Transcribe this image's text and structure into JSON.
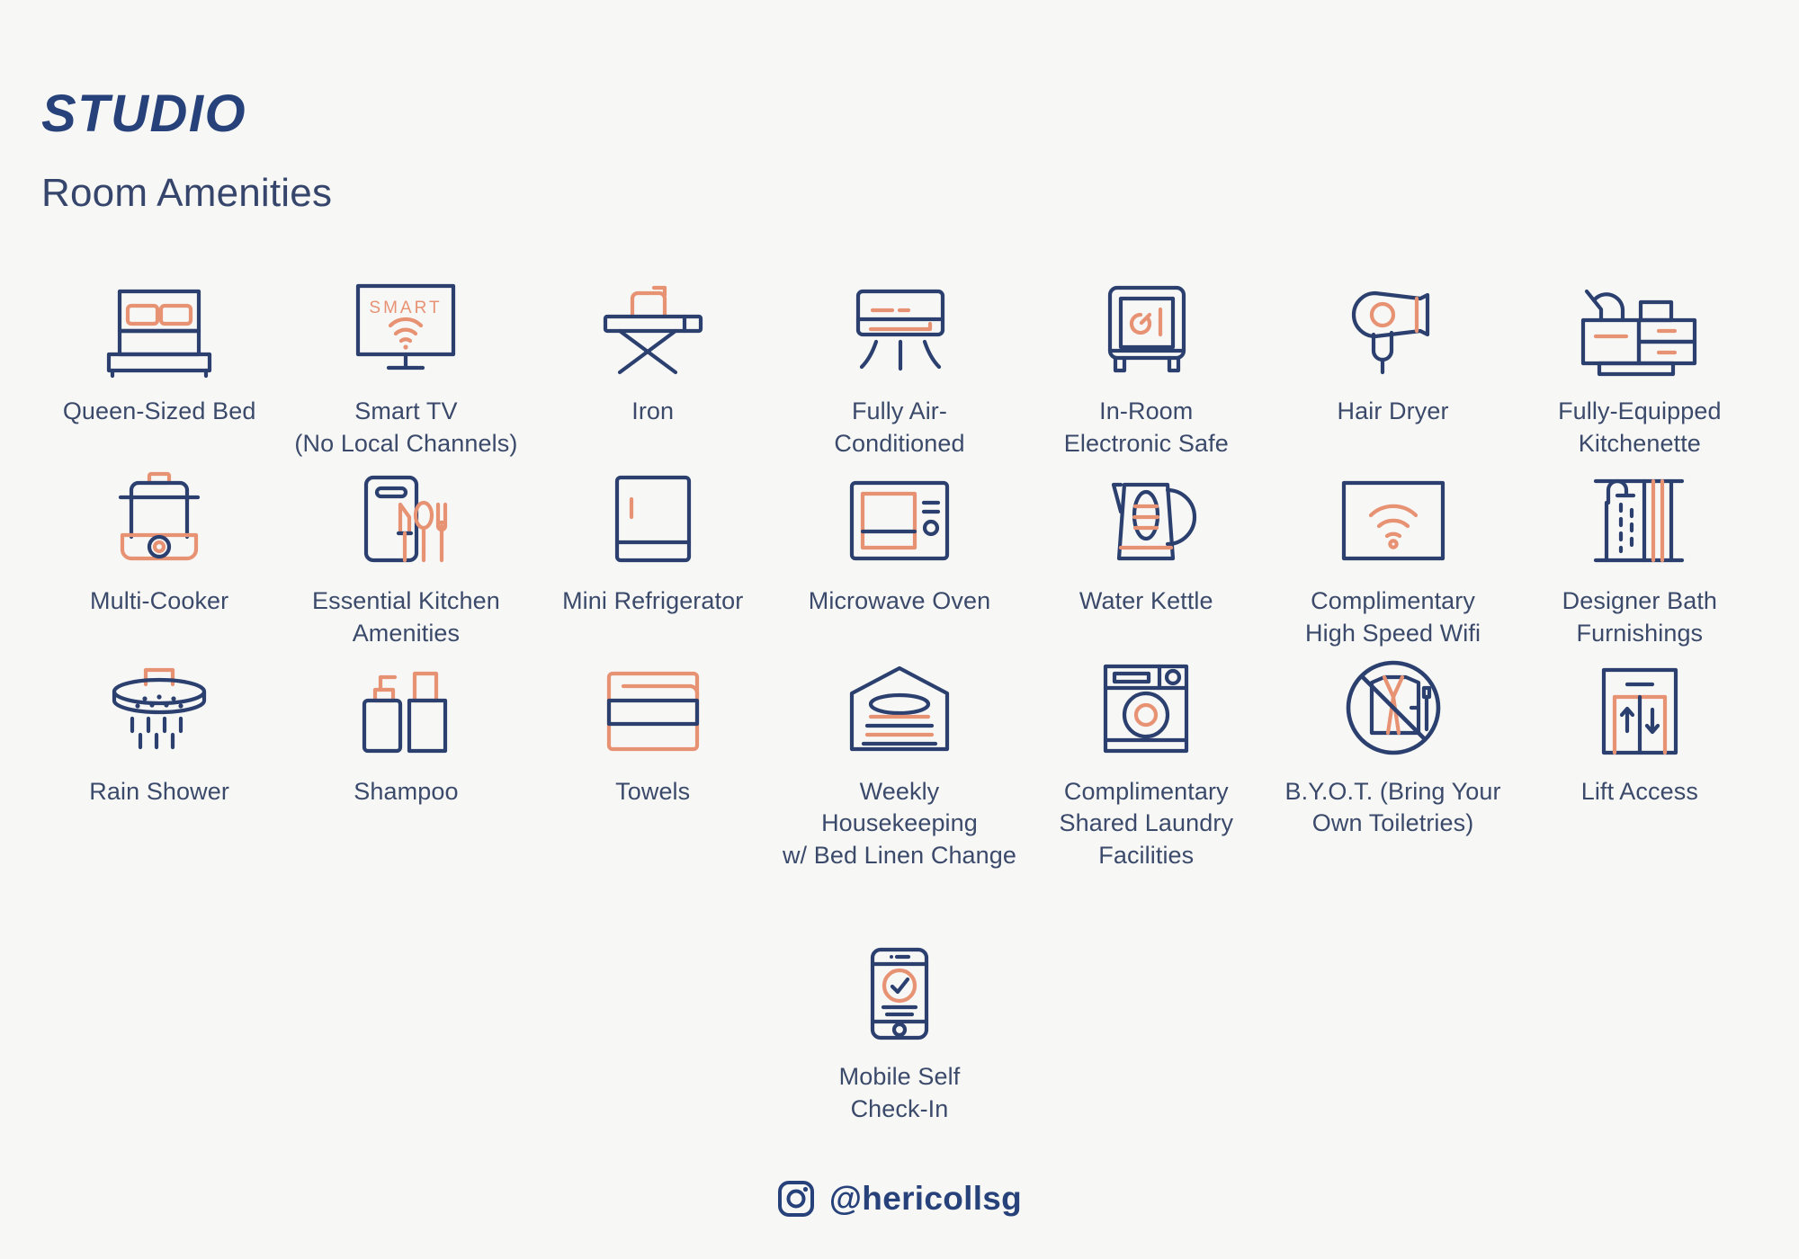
{
  "header": {
    "title": "STUDIO",
    "subtitle": "Room Amenities"
  },
  "colors": {
    "background": "#f7f7f5",
    "navy": "#2c406f",
    "orange": "#e89274",
    "label_text": "#3b4a6b",
    "title_text": "#27427a"
  },
  "amenities": [
    {
      "icon": "bed-icon",
      "label": "Queen-Sized Bed"
    },
    {
      "icon": "smart-tv-icon",
      "label": "Smart TV\n(No Local Channels)"
    },
    {
      "icon": "iron-icon",
      "label": "Iron"
    },
    {
      "icon": "air-conditioner-icon",
      "label": "Fully Air-\nConditioned"
    },
    {
      "icon": "safe-icon",
      "label": "In-Room\nElectronic Safe"
    },
    {
      "icon": "hair-dryer-icon",
      "label": "Hair Dryer"
    },
    {
      "icon": "kitchenette-icon",
      "label": "Fully-Equipped\nKitchenette"
    },
    {
      "icon": "multi-cooker-icon",
      "label": "Multi-Cooker"
    },
    {
      "icon": "cutlery-board-icon",
      "label": "Essential Kitchen\nAmenities"
    },
    {
      "icon": "mini-fridge-icon",
      "label": "Mini Refrigerator"
    },
    {
      "icon": "microwave-icon",
      "label": "Microwave Oven"
    },
    {
      "icon": "kettle-icon",
      "label": "Water Kettle"
    },
    {
      "icon": "wifi-icon",
      "label": "Complimentary\nHigh Speed Wifi"
    },
    {
      "icon": "bath-shower-icon",
      "label": "Designer Bath\nFurnishings"
    },
    {
      "icon": "rain-shower-icon",
      "label": "Rain Shower"
    },
    {
      "icon": "shampoo-icon",
      "label": "Shampoo"
    },
    {
      "icon": "towels-icon",
      "label": "Towels"
    },
    {
      "icon": "housekeeping-icon",
      "label": "Weekly Housekeeping\nw/ Bed Linen Change"
    },
    {
      "icon": "laundry-icon",
      "label": "Complimentary\nShared Laundry\nFacilities"
    },
    {
      "icon": "no-toiletries-icon",
      "label": "B.Y.O.T. (Bring Your\nOwn Toiletries)"
    },
    {
      "icon": "lift-icon",
      "label": "Lift Access"
    },
    {
      "icon": "mobile-checkin-icon",
      "label": "Mobile Self\nCheck-In"
    }
  ],
  "smart_tv_screen_text": "SMART",
  "footer": {
    "icon": "instagram-icon",
    "handle": "@hericollsg"
  }
}
